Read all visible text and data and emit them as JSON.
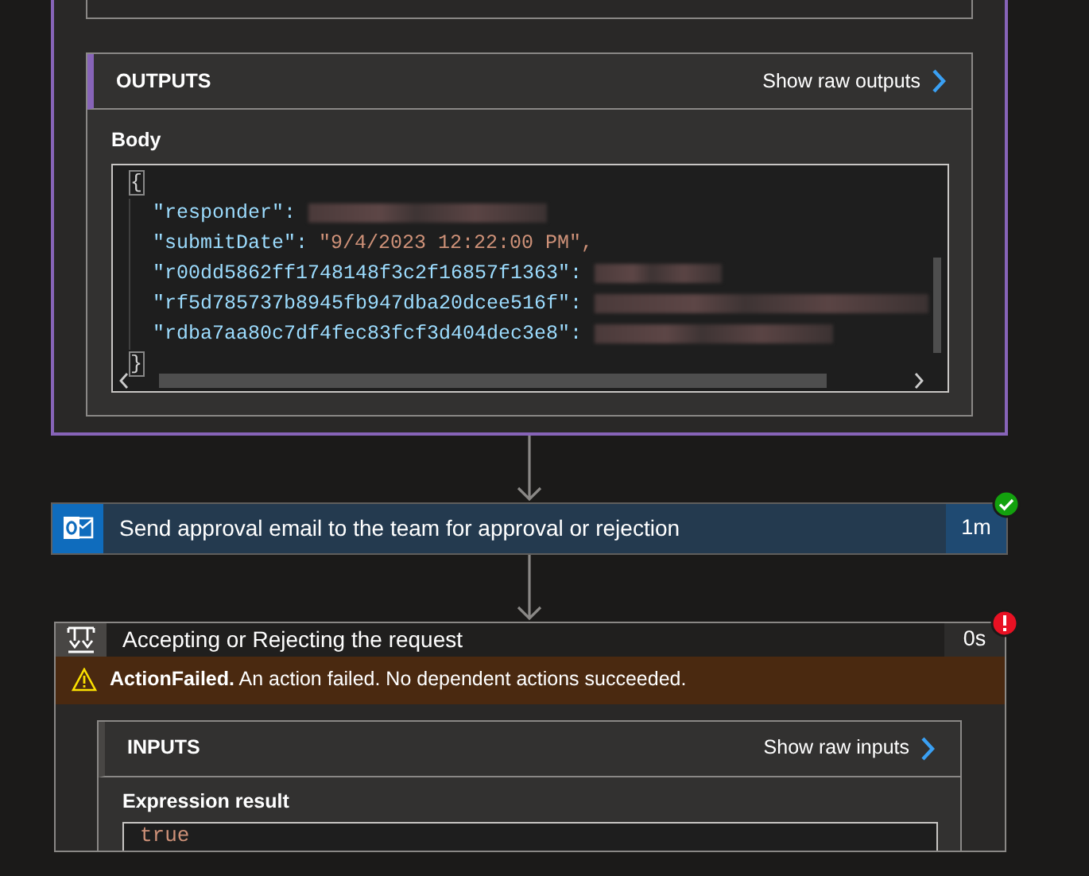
{
  "top_action": {
    "selected": true,
    "panel": {
      "title": "OUTPUTS",
      "raw_link": "Show raw outputs",
      "field_label": "Body",
      "code": {
        "open": "{",
        "close": "}",
        "lines": [
          {
            "key": "\"responder\":",
            "kind": "redacted"
          },
          {
            "key": "\"submitDate\":",
            "kind": "string",
            "value": "\"9/4/2023 12:22:00 PM\","
          },
          {
            "key": "\"r00dd5862ff1748148f3c2f16857f1363\":",
            "kind": "redacted"
          },
          {
            "key": "\"rf5d785737b8945fb947dba20dcee516f\":",
            "kind": "redacted"
          },
          {
            "key": "\"rdba7aa80c7df4fec83fcf3d404dec3e8\":",
            "kind": "redacted"
          }
        ]
      }
    }
  },
  "steps": [
    {
      "kind": "succeeded",
      "title": "Send approval email to the team for approval or rejection",
      "duration": "1m",
      "selected": false
    },
    {
      "kind": "failed",
      "title": "Accepting or Rejecting the request",
      "duration": "0s",
      "selected": false,
      "error": {
        "code": "ActionFailed.",
        "message": "An action failed. No dependent actions succeeded."
      },
      "panel": {
        "title": "INPUTS",
        "raw_link": "Show raw inputs",
        "field_label": "Expression result",
        "value": "true"
      }
    }
  ]
}
